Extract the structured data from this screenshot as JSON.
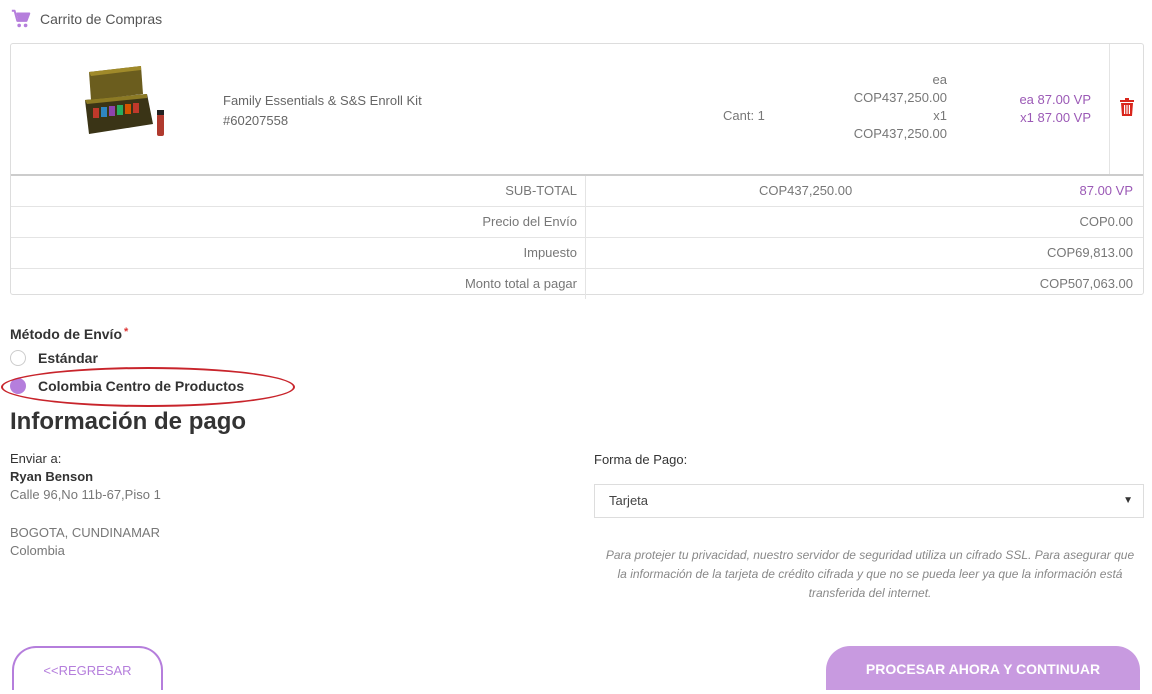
{
  "header": {
    "cart_title": "Carrito de Compras",
    "cart_icon": "shopping-cart-icon"
  },
  "cart": {
    "item": {
      "name": "Family Essentials & S&S Enroll Kit",
      "sku": "#60207558",
      "quantity": "Cant: 1",
      "price_each_label": "ea",
      "price_each": "COP437,250.00",
      "price_multiplier": "x1",
      "price_total": "COP437,250.00",
      "vp_each": "ea 87.00 VP",
      "vp_total": "x1 87.00 VP",
      "delete_icon": "trash-icon"
    },
    "totals": {
      "subtotal_label": "SUB-TOTAL",
      "subtotal_value": "COP437,250.00",
      "subtotal_vp": "87.00 VP",
      "shipping_label": "Precio del Envío",
      "shipping_value": "COP0.00",
      "tax_label": "Impuesto",
      "tax_value": "COP69,813.00",
      "total_label": "Monto total a pagar",
      "total_value": "COP507,063.00"
    }
  },
  "shipping_method": {
    "label": "Método de Envío",
    "required_mark": "*",
    "options": [
      {
        "label": "Estándar",
        "selected": false
      },
      {
        "label": "Colombia Centro de Productos",
        "selected": true
      }
    ]
  },
  "payment": {
    "heading": "Información de pago",
    "ship_to_label": "Enviar a:",
    "name": "Ryan Benson",
    "address_line": "Calle 96,No 11b-67,Piso 1",
    "city_line": "BOGOTA, CUNDINAMAR",
    "country": "Colombia",
    "method_label": "Forma de Pago:",
    "method_value": "Tarjeta",
    "ssl_note": "Para protejer tu privacidad, nuestro servidor de seguridad utiliza un cifrado SSL. Para asegurar que la información de la tarjeta de crédito cifrada y que no se pueda leer ya que la información está transferida del internet."
  },
  "actions": {
    "back_label": "<<REGRESAR",
    "continue_label": "PROCESAR AHORA Y CONTINUAR"
  },
  "colors": {
    "accent": "#b57edc",
    "vp_text": "#9b59b6",
    "annotation_ring": "#c8242b"
  }
}
